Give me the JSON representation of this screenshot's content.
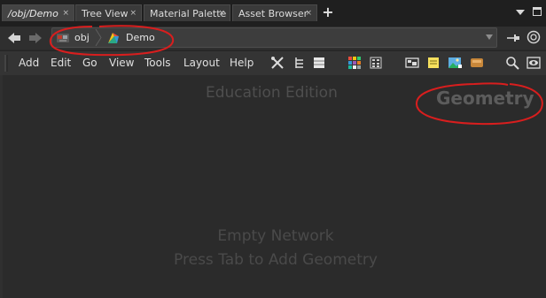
{
  "tabs": [
    {
      "label": "/obj/Demo",
      "active": true
    },
    {
      "label": "Tree View",
      "active": false
    },
    {
      "label": "Material Palette",
      "active": false
    },
    {
      "label": "Asset Browser",
      "active": false
    }
  ],
  "tab_close_glyph": "×",
  "tab_add_glyph": "+",
  "path": {
    "crumbs": [
      "obj",
      "Demo"
    ]
  },
  "menu": [
    "Add",
    "Edit",
    "Go",
    "View",
    "Tools",
    "Layout",
    "Help"
  ],
  "network": {
    "edition": "Education Edition",
    "context": "Geometry",
    "empty_title": "Empty Network",
    "empty_hint": "Press Tab to Add Geometry"
  },
  "colors": {
    "annotation": "#d81e1e",
    "background": "#2b2b2b",
    "tab_active": "#444444"
  },
  "icons": [
    "back-arrow-icon",
    "forward-arrow-icon",
    "obj-network-icon",
    "geo-node-icon",
    "pin-icon",
    "globe-icon",
    "tools-icon",
    "tree-icon",
    "list-icon",
    "color-grid-icon",
    "parameters-icon",
    "sticky-note-icon",
    "image-icon",
    "network-box-icon",
    "search-icon",
    "eye-icon"
  ]
}
